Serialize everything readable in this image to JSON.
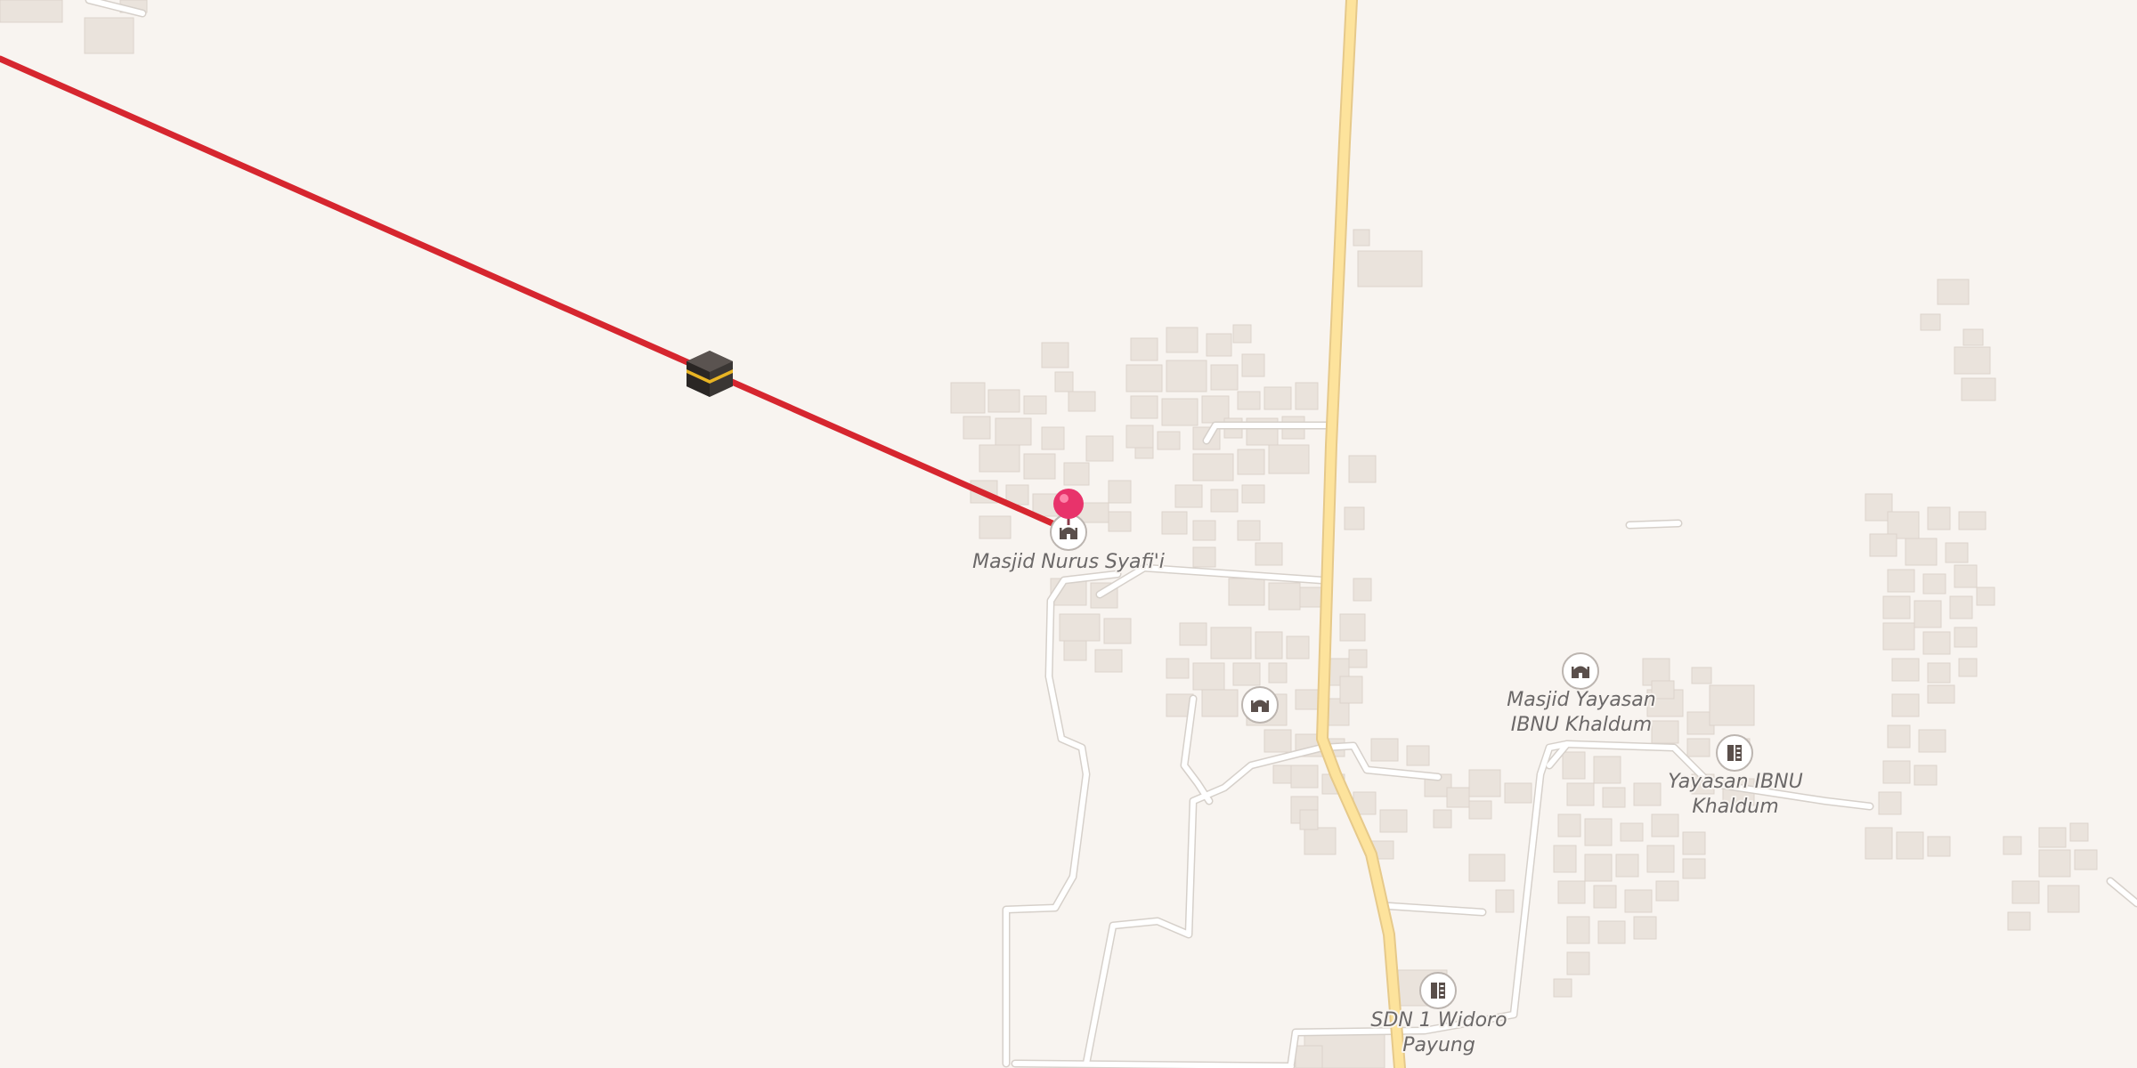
{
  "map": {
    "background_color": "#f8f4f0",
    "building_color": "#eae3dc",
    "minor_road_color": "#ffffff",
    "main_road_color": "#fde39c",
    "qibla_line_color": "#d6262f",
    "marker_color": "#e8336b"
  },
  "qibla": {
    "kaaba_icon": "kaaba-icon",
    "marker_icon": "location-pin-icon"
  },
  "pois": [
    {
      "icon": "mosque-icon",
      "label_lines": [
        "Masjid Nurus Syafi'i"
      ]
    },
    {
      "icon": "mosque-icon",
      "label_lines": []
    },
    {
      "icon": "mosque-icon",
      "label_lines": [
        "Masjid Yayasan",
        "IBNU Khaldum"
      ]
    },
    {
      "icon": "school-icon",
      "label_lines": [
        "Yayasan IBNU",
        "Khaldum"
      ]
    },
    {
      "icon": "school-icon",
      "label_lines": [
        "SDN 1 Widoro",
        "Payung"
      ]
    }
  ]
}
